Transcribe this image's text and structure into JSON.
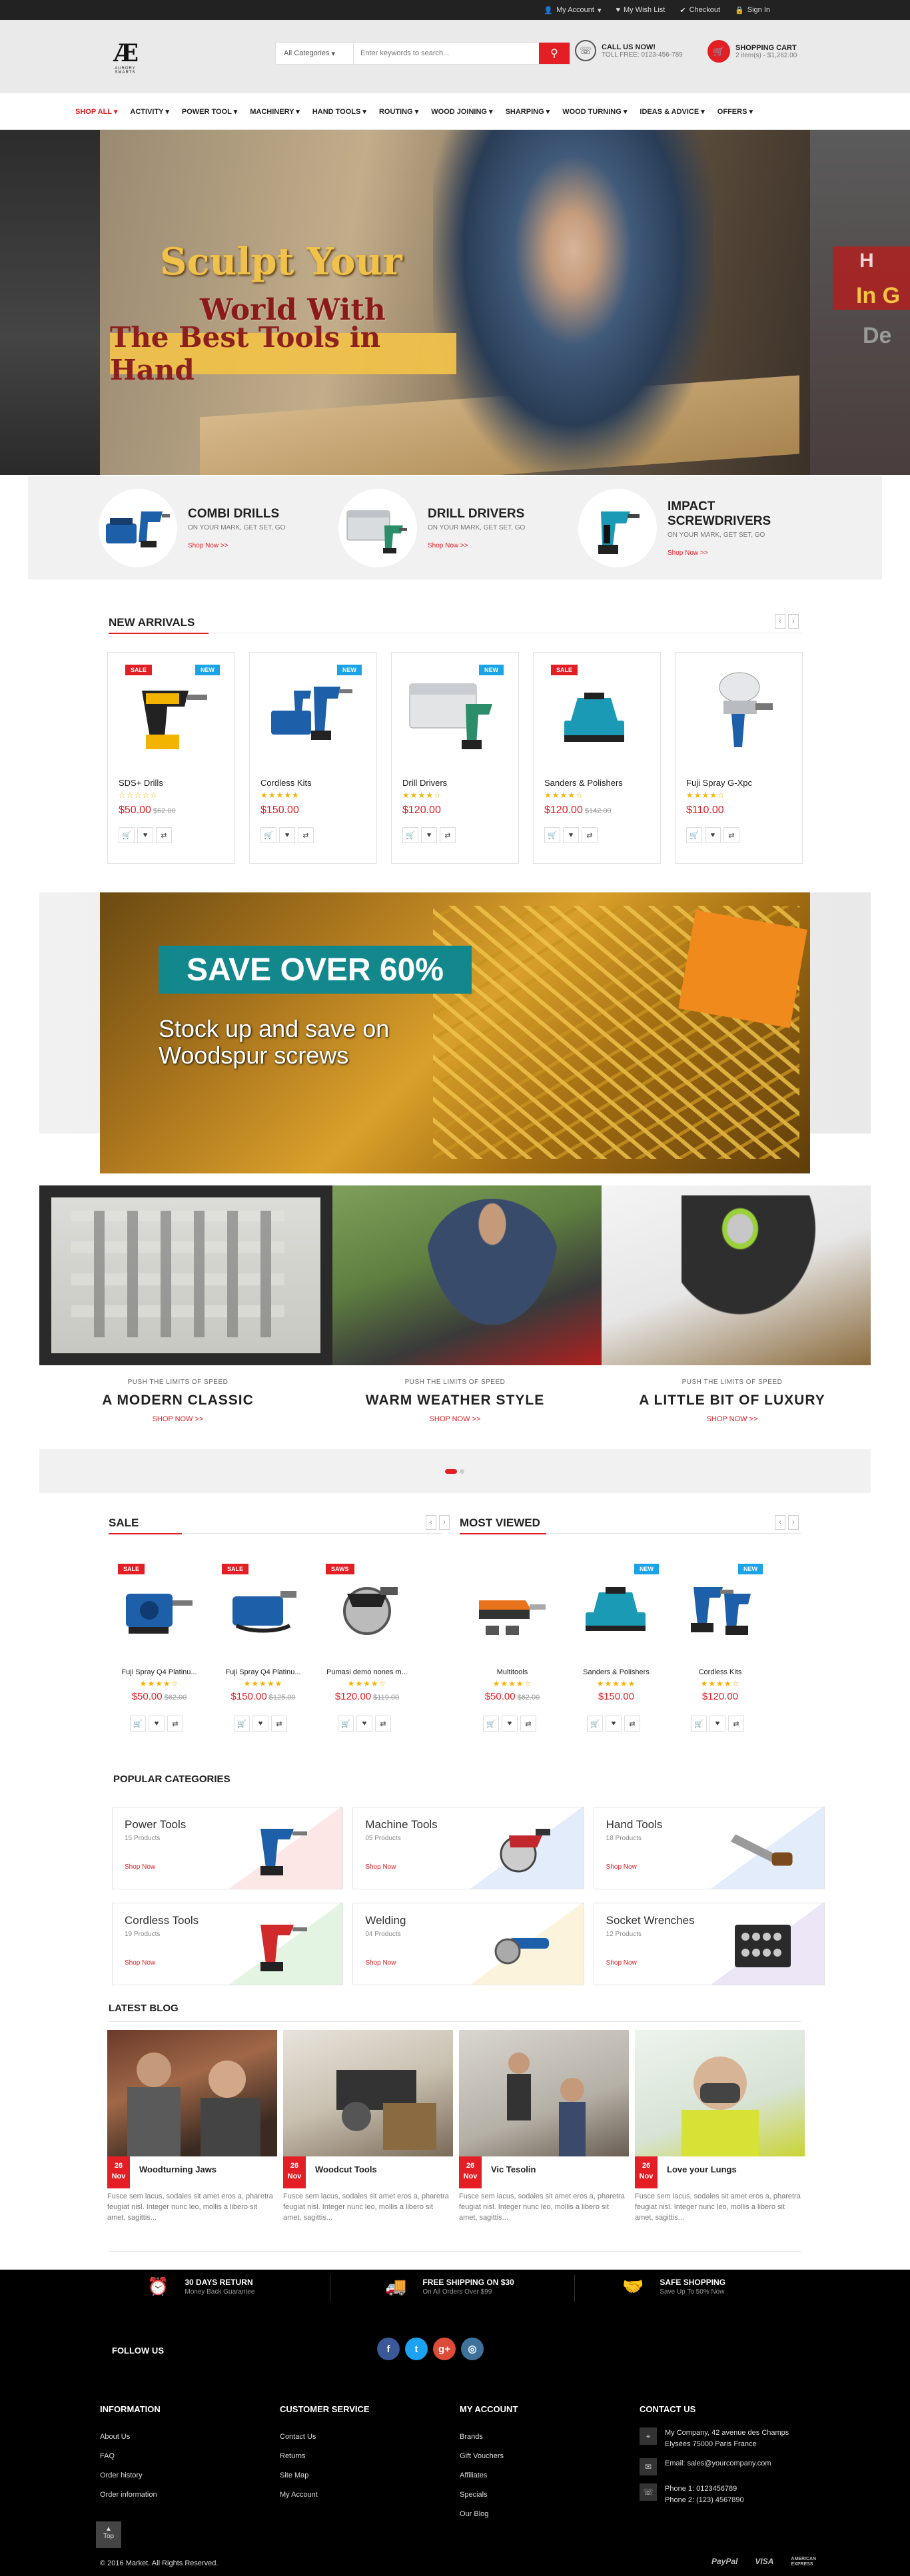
{
  "topbar": {
    "my_account": "My Account",
    "wishlist": "My Wish List",
    "checkout": "Checkout",
    "signin": "Sign In"
  },
  "header": {
    "logo_sub": "AURORY SMARTS",
    "category_select": "All Categories",
    "search_placeholder": "Enter keywords to search...",
    "call_title": "CALL US NOW!",
    "call_text": "TOLL FREE: 0123-456-789",
    "cart_title": "SHOPPING CART",
    "cart_text": "2 item(s) - $1,262.00"
  },
  "nav": [
    "SHOP ALL",
    "ACTIVITY",
    "POWER TOOL",
    "MACHINERY",
    "HAND TOOLS",
    "ROUTING",
    "WOOD JOINING",
    "SHARPING",
    "WOOD TURNING",
    "IDEAS & ADVICE",
    "OFFERS"
  ],
  "hero": {
    "line1": "Sculpt Your",
    "line2": "World With",
    "line3": "The Best Tools in Hand",
    "side1": "H",
    "side2": "In G",
    "side3": "De"
  },
  "featured": [
    {
      "title1": "COMBI DRILLS",
      "title2": "",
      "sub": "ON YOUR MARK, GET SET, GO",
      "link": "Shop Now >>"
    },
    {
      "title1": "DRILL DRIVERS",
      "title2": "",
      "sub": "ON YOUR MARK, GET SET, GO",
      "link": "Shop Now >>"
    },
    {
      "title1": "IMPACT",
      "title2": "SCREWDRIVERS",
      "sub": "ON YOUR MARK, GET SET, GO",
      "link": "Shop Now >>"
    }
  ],
  "new_arrivals": {
    "title": "NEW ARRIVALS",
    "products": [
      {
        "name": "SDS+ Drills",
        "price": "$50.00",
        "old": "$62.00",
        "stars": "☆☆☆☆☆",
        "badge": "SALE",
        "badge_new": "NEW",
        "icon": "drill-icon"
      },
      {
        "name": "Cordless Kits",
        "price": "$150.00",
        "old": "",
        "stars": "★★★★★",
        "badge": "",
        "badge_new": "NEW",
        "icon": "cordless-kit-icon"
      },
      {
        "name": "Drill Drivers",
        "price": "$120.00",
        "old": "",
        "stars": "★★★★☆",
        "badge": "",
        "badge_new": "NEW",
        "icon": "drill-driver-icon"
      },
      {
        "name": "Sanders & Polishers",
        "price": "$120.00",
        "old": "$142.00",
        "stars": "★★★★☆",
        "badge": "SALE",
        "badge_new": "",
        "icon": "sander-icon"
      },
      {
        "name": "Fuji Spray G-Xpc",
        "price": "$110.00",
        "old": "",
        "stars": "★★★★☆",
        "badge": "",
        "badge_new": "",
        "icon": "spray-gun-icon"
      }
    ]
  },
  "promo": {
    "save": "SAVE OVER 60%",
    "stock": "Stock up and save on Woodspur screws"
  },
  "triptych": [
    {
      "small": "PUSH THE LIMITS OF SPEED",
      "big": "A MODERN CLASSIC",
      "link": "SHOP NOW >>"
    },
    {
      "small": "PUSH THE LIMITS OF SPEED",
      "big": "WARM WEATHER STYLE",
      "link": "SHOP NOW >>"
    },
    {
      "small": "PUSH THE LIMITS OF SPEED",
      "big": "A LITTLE BIT OF LUXURY",
      "link": "SHOP NOW >>"
    }
  ],
  "sale": {
    "title": "SALE",
    "products": [
      {
        "name": "Fuji Spray Q4 Platinu...",
        "price": "$50.00",
        "old": "$62.00",
        "stars": "★★★★☆",
        "badge": "SALE",
        "badge_new": ""
      },
      {
        "name": "Fuji Spray Q4 Platinu...",
        "price": "$150.00",
        "old": "$125.00",
        "stars": "★★★★★",
        "badge": "SALE",
        "badge_new": ""
      },
      {
        "name": "Pumasi demo nones m...",
        "price": "$120.00",
        "old": "$119.00",
        "stars": "★★★★☆",
        "badge": "SAWS",
        "badge_new": ""
      }
    ]
  },
  "most_viewed": {
    "title": "MOST VIEWED",
    "products": [
      {
        "name": "Multitools",
        "price": "$50.00",
        "old": "$62.00",
        "stars": "★★★★☆",
        "badge": "",
        "badge_new": ""
      },
      {
        "name": "Sanders & Polishers",
        "price": "$150.00",
        "old": "",
        "stars": "★★★★★",
        "badge": "",
        "badge_new": "NEW"
      },
      {
        "name": "Cordless Kits",
        "price": "$120.00",
        "old": "",
        "stars": "★★★★☆",
        "badge": "",
        "badge_new": "NEW"
      }
    ]
  },
  "popular": {
    "title": "POPULAR CATEGORIES",
    "items": [
      {
        "name": "Power Tools",
        "count": "15 Products",
        "link": "Shop Now",
        "tint": "#fde6e6"
      },
      {
        "name": "Machine Tools",
        "count": "05 Products",
        "link": "Shop Now",
        "tint": "#e3ecfb"
      },
      {
        "name": "Hand Tools",
        "count": "18 Products",
        "link": "Shop Now",
        "tint": "#e3ecfb"
      },
      {
        "name": "Cordless Tools",
        "count": "19 Products",
        "link": "Shop Now",
        "tint": "#e3f4e3"
      },
      {
        "name": "Welding",
        "count": "04 Products",
        "link": "Shop Now",
        "tint": "#fbf3dc"
      },
      {
        "name": "Socket Wrenches",
        "count": "12 Products",
        "link": "Shop Now",
        "tint": "#ece6f7"
      }
    ]
  },
  "blog": {
    "title": "LATEST BLOG",
    "posts": [
      {
        "day": "26",
        "month": "Nov",
        "title": "Woodturning Jaws",
        "text": "Fusce sem lacus, sodales sit amet eros a, pharetra feugiat nisl. Integer nunc leo, mollis a libero sit amet, sagittis..."
      },
      {
        "day": "26",
        "month": "Nov",
        "title": "Woodcut Tools",
        "text": "Fusce sem lacus, sodales sit amet eros a, pharetra feugiat nisl. Integer nunc leo, mollis a libero sit amet, sagittis..."
      },
      {
        "day": "26",
        "month": "Nov",
        "title": "Vic Tesolin",
        "text": "Fusce sem lacus, sodales sit amet eros a, pharetra feugiat nisl. Integer nunc leo, mollis a libero sit amet, sagittis..."
      },
      {
        "day": "26",
        "month": "Nov",
        "title": "Love your Lungs",
        "text": "Fusce sem lacus, sodales sit amet eros a, pharetra feugiat nisl. Integer nunc leo, mollis a libero sit amet, sagittis..."
      }
    ]
  },
  "features": [
    {
      "title": "30 DAYS RETURN",
      "sub": "Money Back Guarantee"
    },
    {
      "title": "FREE SHIPPING ON $30",
      "sub": "On All Orders Over $99"
    },
    {
      "title": "SAFE SHOPPING",
      "sub": "Save Up To 50% Now"
    }
  ],
  "footer": {
    "follow": "FOLLOW US",
    "info": {
      "title": "INFORMATION",
      "links": [
        "About Us",
        "FAQ",
        "Order history",
        "Order information"
      ]
    },
    "service": {
      "title": "CUSTOMER SERVICE",
      "links": [
        "Contact Us",
        "Returns",
        "Site Map",
        "My Account"
      ]
    },
    "account": {
      "title": "MY ACCOUNT",
      "links": [
        "Brands",
        "Gift Vouchers",
        "Affiliates",
        "Specials",
        "Our Blog"
      ]
    },
    "contact": {
      "title": "CONTACT US",
      "address": "My Company, 42 avenue des Champs Elysées 75000 Paris France",
      "email": "Email: sales@yourcompany.com",
      "phone1": "Phone 1: 0123456789",
      "phone2": "Phone 2: (123) 4567890"
    },
    "top": "Top",
    "copyright": "© 2016 Market. All Rights Reserved.",
    "payments": [
      "PayPal",
      "VISA",
      "AMERICAN EXPRESS"
    ]
  },
  "colors": {
    "accent": "#e31e24",
    "new_badge": "#1ba3e8",
    "dark": "#000000"
  }
}
